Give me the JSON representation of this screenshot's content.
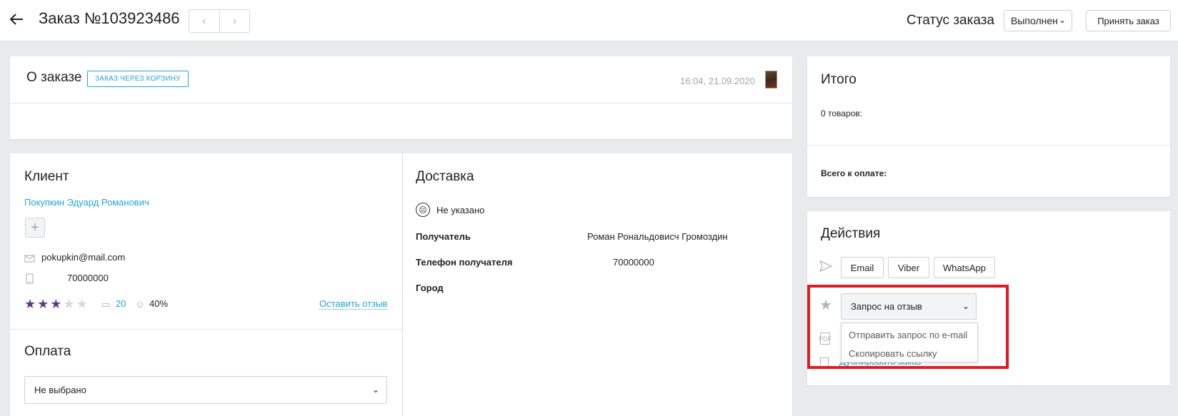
{
  "header": {
    "order_title": "Заказ №103923486",
    "status_label": "Статус заказа",
    "status_value": "Выполнен",
    "accept_label": "Принять заказ"
  },
  "about": {
    "title": "О заказе",
    "badge": "ЗАКАЗ ЧЕРЕЗ КОРЗИНУ",
    "datetime": "16:04, 21.09.2020"
  },
  "client": {
    "title": "Клиент",
    "name": "Покупкин Эдуард Романович",
    "email": "pokupkin@mail.com",
    "phone": "70000000",
    "rating": 3,
    "rating_max": 5,
    "reviews_count": "20",
    "positive_percent": "40%",
    "leave_review": "Оставить отзыв"
  },
  "payment": {
    "title": "Оплата",
    "selected": "Не выбрано"
  },
  "delivery": {
    "title": "Доставка",
    "status": "Не указано",
    "recipient_label": "Получатель",
    "recipient_value": "Роман Рональдовисч Громоздин",
    "phone_label": "Телефон получателя",
    "phone_value": "70000000",
    "city_label": "Город"
  },
  "total": {
    "title": "Итого",
    "items": "0 товаров:",
    "to_pay": "Всего к оплате:"
  },
  "actions": {
    "title": "Действия",
    "buttons": [
      "Email",
      "Viber",
      "WhatsApp"
    ],
    "review_select": "Запрос на отзыв",
    "dropdown_items": [
      "Отправить запрос по e-mail",
      "Скопировать ссылку"
    ],
    "duplicate_link": "Дублировать заказ"
  },
  "colors": {
    "accent_link": "#27a4d6",
    "star_active": "#5b3b8c",
    "highlight_box": "#e11b24"
  }
}
